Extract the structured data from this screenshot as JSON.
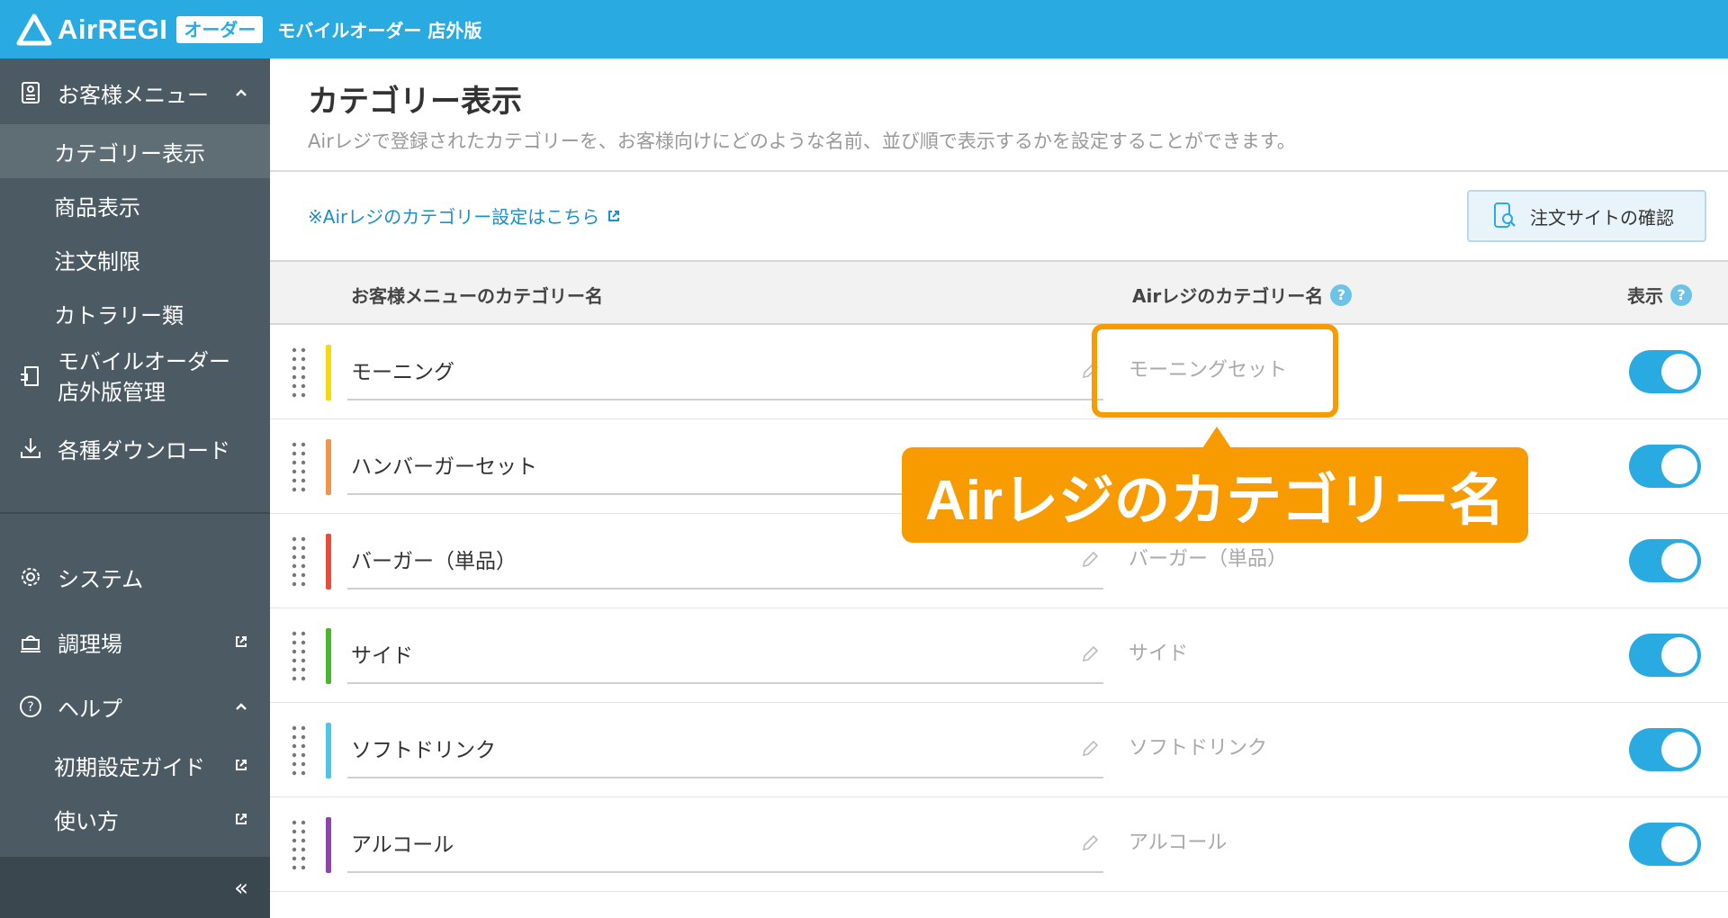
{
  "header": {
    "logo_text": "AirREGI",
    "logo_badge": "オーダー",
    "app_title": "モバイルオーダー 店外版"
  },
  "sidebar": {
    "items": [
      {
        "label": "お客様メニュー",
        "icon": "menu-book-icon"
      },
      {
        "label": "カテゴリー表示"
      },
      {
        "label": "商品表示"
      },
      {
        "label": "注文制限"
      },
      {
        "label": "カトラリー類"
      },
      {
        "label": "モバイルオーダー",
        "label2": "店外版管理",
        "icon": "mobile-order-icon"
      },
      {
        "label": "各種ダウンロード",
        "icon": "download-icon"
      },
      {
        "label": "システム",
        "icon": "gear-icon"
      },
      {
        "label": "調理場",
        "icon": "kitchen-icon"
      },
      {
        "label": "ヘルプ",
        "icon": "help-icon"
      },
      {
        "label": "初期設定ガイド"
      },
      {
        "label": "使い方"
      }
    ],
    "collapse_label": "«"
  },
  "main": {
    "title": "カテゴリー表示",
    "description": "Airレジで登録されたカテゴリーを、お客様向けにどのような名前、並び順で表示するかを設定することができます。",
    "link_text": "※Airレジのカテゴリー設定はこちら",
    "confirm_button": "注文サイトの確認",
    "columns": {
      "customer_name": "お客様メニューのカテゴリー名",
      "air_name": "Airレジのカテゴリー名",
      "display": "表示"
    },
    "rows": [
      {
        "name": "モーニング",
        "air_name": "モーニングセット",
        "color": "#f5d90a",
        "visible": true
      },
      {
        "name": "ハンバーガーセット",
        "air_name": "",
        "color": "#f0954a",
        "visible": true
      },
      {
        "name": "バーガー（単品）",
        "air_name": "バーガー（単品）",
        "color": "#e94b3c",
        "visible": true
      },
      {
        "name": "サイド",
        "air_name": "サイド",
        "color": "#4cb52f",
        "visible": true
      },
      {
        "name": "ソフトドリンク",
        "air_name": "ソフトドリンク",
        "color": "#4dc5e8",
        "visible": true
      },
      {
        "name": "アルコール",
        "air_name": "アルコール",
        "color": "#8e44ad",
        "visible": true
      }
    ]
  },
  "callout": {
    "text": "Airレジのカテゴリー名",
    "color": "#f79b00"
  },
  "colors": {
    "brand": "#29abe2",
    "sidebar": "#4b5a63",
    "accent": "#f79b00"
  }
}
